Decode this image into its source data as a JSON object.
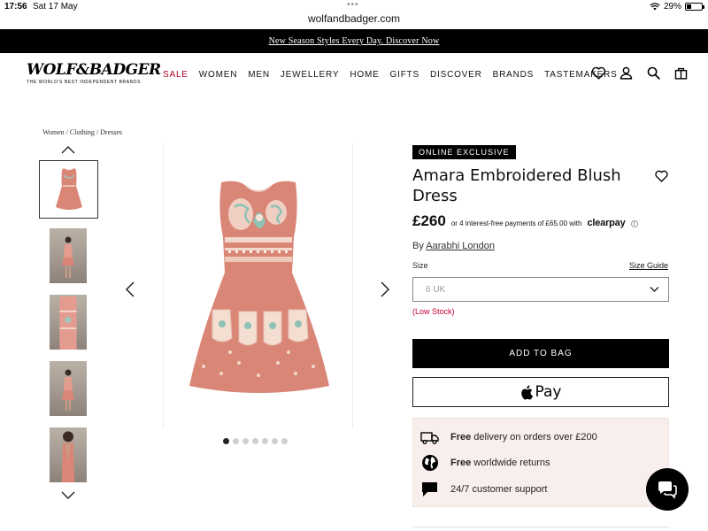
{
  "status_bar": {
    "time": "17:56",
    "date": "Sat 17 May",
    "battery": "29%",
    "battery_level": 0.29
  },
  "browser": {
    "url": "wolfandbadger.com"
  },
  "promo": {
    "text": "New Season Styles Every Day. Discover Now"
  },
  "header": {
    "logo": "WOLF&BADGER",
    "tagline": "THE WORLD'S BEST INDEPENDENT BRANDS",
    "nav": [
      "SALE",
      "WOMEN",
      "MEN",
      "JEWELLERY",
      "HOME",
      "GIFTS",
      "DISCOVER",
      "BRANDS",
      "TASTEMAKERS"
    ],
    "icons": [
      "heart-icon",
      "user-icon",
      "search-icon",
      "bag-icon"
    ]
  },
  "breadcrumb": "Women / Clothing / Dresses",
  "gallery": {
    "thumbnail_count": 5,
    "selected_index": 0,
    "dot_count": 7,
    "active_dot": 0
  },
  "product": {
    "badge": "ONLINE EXCLUSIVE",
    "title": "Amara Embroidered Blush Dress",
    "price": "£260",
    "installments": "or 4 interest-free payments of £65.00 with",
    "clearpay": "clearpay",
    "by_label": "By",
    "brand": "Aarabhi London",
    "size_label": "Size",
    "size_guide": "Size Guide",
    "size_selected": "6 UK",
    "stock_status": "(Low Stock)",
    "add_to_bag": "ADD TO BAG",
    "apple_pay": "Pay"
  },
  "perks": [
    {
      "bold": "Free",
      "text": " delivery on orders over £200",
      "icon": "truck-icon"
    },
    {
      "bold": "Free",
      "text": " worldwide returns",
      "icon": "globe-icon"
    },
    {
      "bold": "",
      "text": "24/7 customer support",
      "icon": "chat-bubble-icon"
    }
  ],
  "colors": {
    "sale_red": "#b0001e",
    "low_stock_red": "#c3002f",
    "dress_pink": "#d98676",
    "perks_bg": "#f8eeec"
  }
}
